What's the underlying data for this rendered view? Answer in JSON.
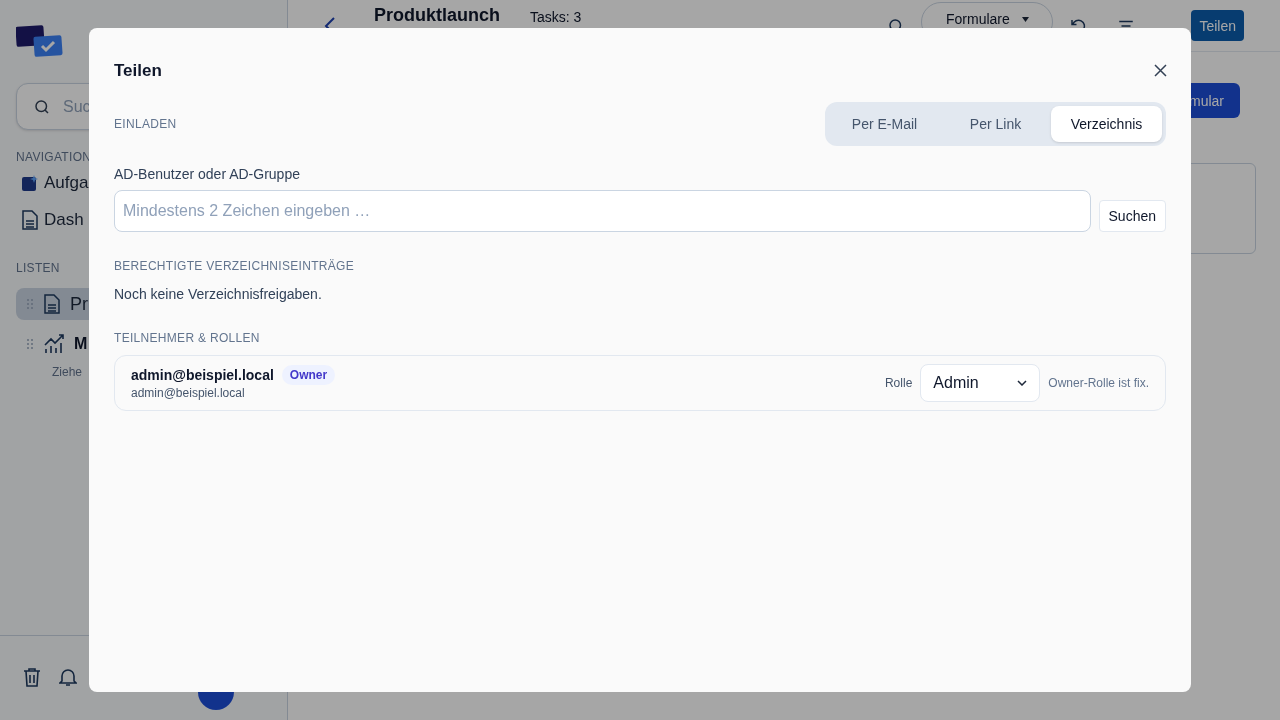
{
  "background": {
    "sidebar": {
      "search_placeholder": "Suc",
      "nav_heading": "NAVIGATION",
      "nav_items": [
        {
          "label": "Aufga",
          "kind": "sparkle"
        },
        {
          "label": "Dash",
          "kind": "document"
        }
      ],
      "lists_heading": "LISTEN",
      "lists": [
        {
          "label": "Pr",
          "kind": "document",
          "selected": true
        },
        {
          "label": "M",
          "kind": "chart",
          "selected": false
        }
      ],
      "hint": "Ziehe"
    },
    "header": {
      "title": "Produktlaunch",
      "task_count": "Tasks: 3",
      "forms_dropdown": "Formulare",
      "share_button": "Teilen",
      "form_button": "mular"
    }
  },
  "dialog": {
    "title": "Teilen",
    "invite_heading": "EINLADEN",
    "tabs": [
      {
        "label": "Per E-Mail",
        "selected": false
      },
      {
        "label": "Per Link",
        "selected": false
      },
      {
        "label": "Verzeichnis",
        "selected": true
      }
    ],
    "search": {
      "label": "AD-Benutzer oder AD-Gruppe",
      "placeholder": "Mindestens 2 Zeichen eingeben …",
      "button": "Suchen"
    },
    "directory_heading": "BERECHTIGTE VERZEICHNISEINTRÄGE",
    "directory_empty": "Noch keine Verzeichnisfreigaben.",
    "participants_heading": "TEILNEHMER & ROLLEN",
    "participants": [
      {
        "name": "admin@beispiel.local",
        "badge": "Owner",
        "email": "admin@beispiel.local",
        "role_label": "Rolle",
        "role": "Admin",
        "note": "Owner-Rolle ist fix."
      }
    ]
  }
}
